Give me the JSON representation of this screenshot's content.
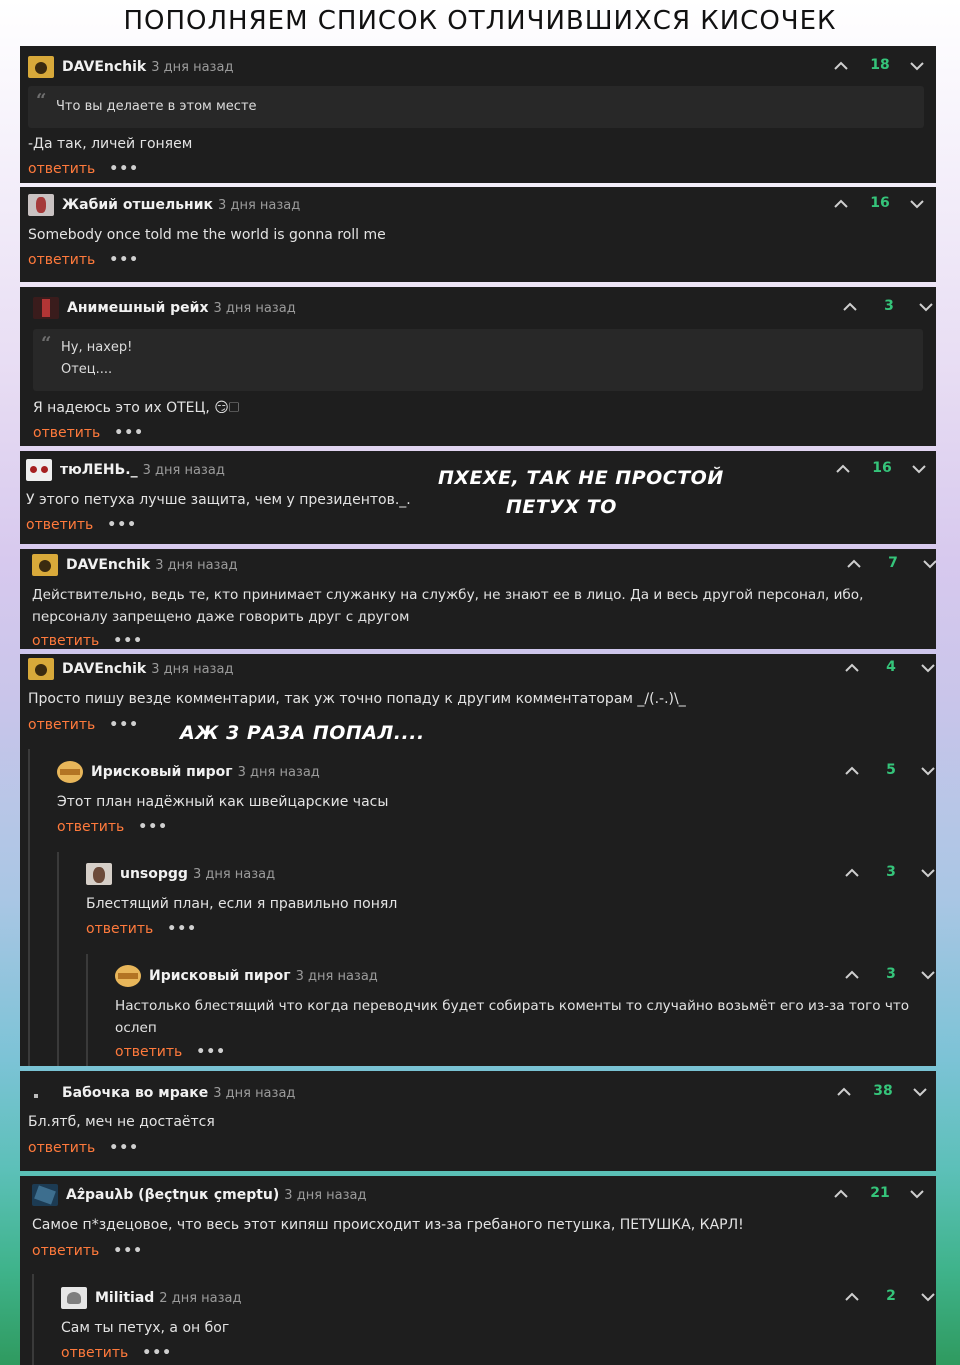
{
  "page_title": "ПОПОЛНЯЕМ СПИСОК ОТЛИЧИВШИХСЯ КИСОЧЕК",
  "colors": {
    "card_bg": "#1e1e1e",
    "reply": "#ff7a3c",
    "score": "#35c47a"
  },
  "icons": {
    "upvote": "chevron-up-icon",
    "downvote": "chevron-down-icon",
    "quote": "quote-icon"
  },
  "ui": {
    "reply": "ответить",
    "more": "•••"
  },
  "comments": [
    {
      "author": "DAVEnchik",
      "time": "3 дня назад",
      "score": "18",
      "quote": [
        "Что вы делаете в этом месте"
      ],
      "text": "-Да так, личей гоняем"
    },
    {
      "author": "Жабий отшельник",
      "time": "3 дня назад",
      "score": "16",
      "text": "Somebody once told me the world is gonna roll me"
    },
    {
      "author": "Анимешный рейх",
      "time": "3 дня назад",
      "score": "3",
      "quote": [
        "Ну, нахер!",
        "Отец...."
      ],
      "text": "Я надеюсь это их ОТЕЦ, 😏🗆"
    },
    {
      "author": "тюЛЕНЬ._",
      "time": "3 дня назад",
      "score": "16",
      "text": "У этого петуха лучше защита, чем у президентов._."
    },
    {
      "author": "DAVEnchik",
      "time": "3 дня назад",
      "score": "7",
      "text": "Действительно, ведь те, кто принимает служанку на службу, не знают ее в лицо. Да и весь другой персонал, ибо, персоналу запрещено даже говорить друг с другом"
    },
    {
      "author": "DAVEnchik",
      "time": "3 дня назад",
      "score": "4",
      "text": "Просто пишу везде комментарии, так уж точно попаду к другим комментаторам _/(.-.)\\_"
    },
    {
      "author": "Ирисковый пирог",
      "time": "3 дня назад",
      "score": "5",
      "text": "Этот план надёжный как швейцарские часы"
    },
    {
      "author": "unsopgg",
      "time": "3 дня назад",
      "score": "3",
      "text": "Блестящий план, если я правильно понял"
    },
    {
      "author": "Ирисковый пирог",
      "time": "3 дня назад",
      "score": "3",
      "text": "Настолько блестящий что когда переводчик будет собирать коменты то случайно возьмёт его из-за того что ослеп"
    },
    {
      "author": "Бабочка во мраке",
      "time": "3 дня назад",
      "score": "38",
      "text": "Бл.ятб, меч не достаётся"
    },
    {
      "author": "Aẑpauλb (βeçtηuκ çmeptu)",
      "time": "3 дня назад",
      "score": "21",
      "text": "Самое п*здецовое, что весь этот кипяш происходит из-за гребаного петушка, ПЕТУШКА, КАРЛ!"
    },
    {
      "author": "Militiad",
      "time": "2 дня назад",
      "score": "2",
      "text": "Сам ты петух, а он бог"
    }
  ],
  "notes": [
    "ПХЕХЕ, ТАК НЕ ПРОСТОЙ",
    "ПЕТУХ ТО",
    "АЖ 3 РАЗА ПОПАЛ...."
  ]
}
